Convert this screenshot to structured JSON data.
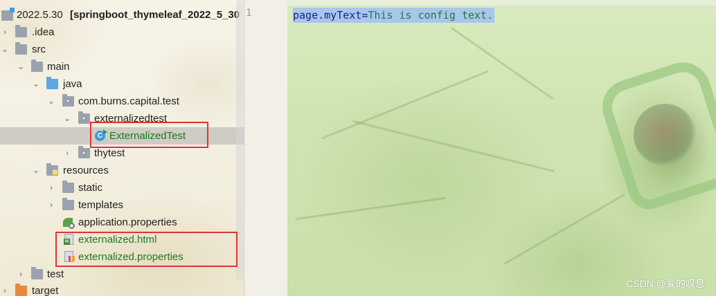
{
  "tree": {
    "root": {
      "name": "2022.5.30",
      "module": "[springboot_thymeleaf_2022_5_30"
    },
    "idea": ".idea",
    "src": "src",
    "main": "main",
    "java": "java",
    "package": "com.burns.capital.test",
    "externalizedtest": "externalizedtest",
    "externalized_class": "ExternalizedTest",
    "thytest": "thytest",
    "resources": "resources",
    "static": "static",
    "templates": "templates",
    "app_props": "application.properties",
    "ext_html": "externalized.html",
    "ext_props": "externalized.properties",
    "test": "test",
    "target": "target"
  },
  "editor": {
    "line_number": "1",
    "key": "page.myText",
    "eq": "=",
    "value": "This is config text."
  },
  "watermark": "CSDN @爱的叹息",
  "colors": {
    "highlight": "#e03333",
    "selection": "#a9c6ec",
    "vcs_added": "#1d7a1d"
  },
  "icons": [
    "folder-icon",
    "module-icon",
    "package-icon",
    "class-icon",
    "html-file-icon",
    "properties-file-icon",
    "spring-properties-icon"
  ]
}
